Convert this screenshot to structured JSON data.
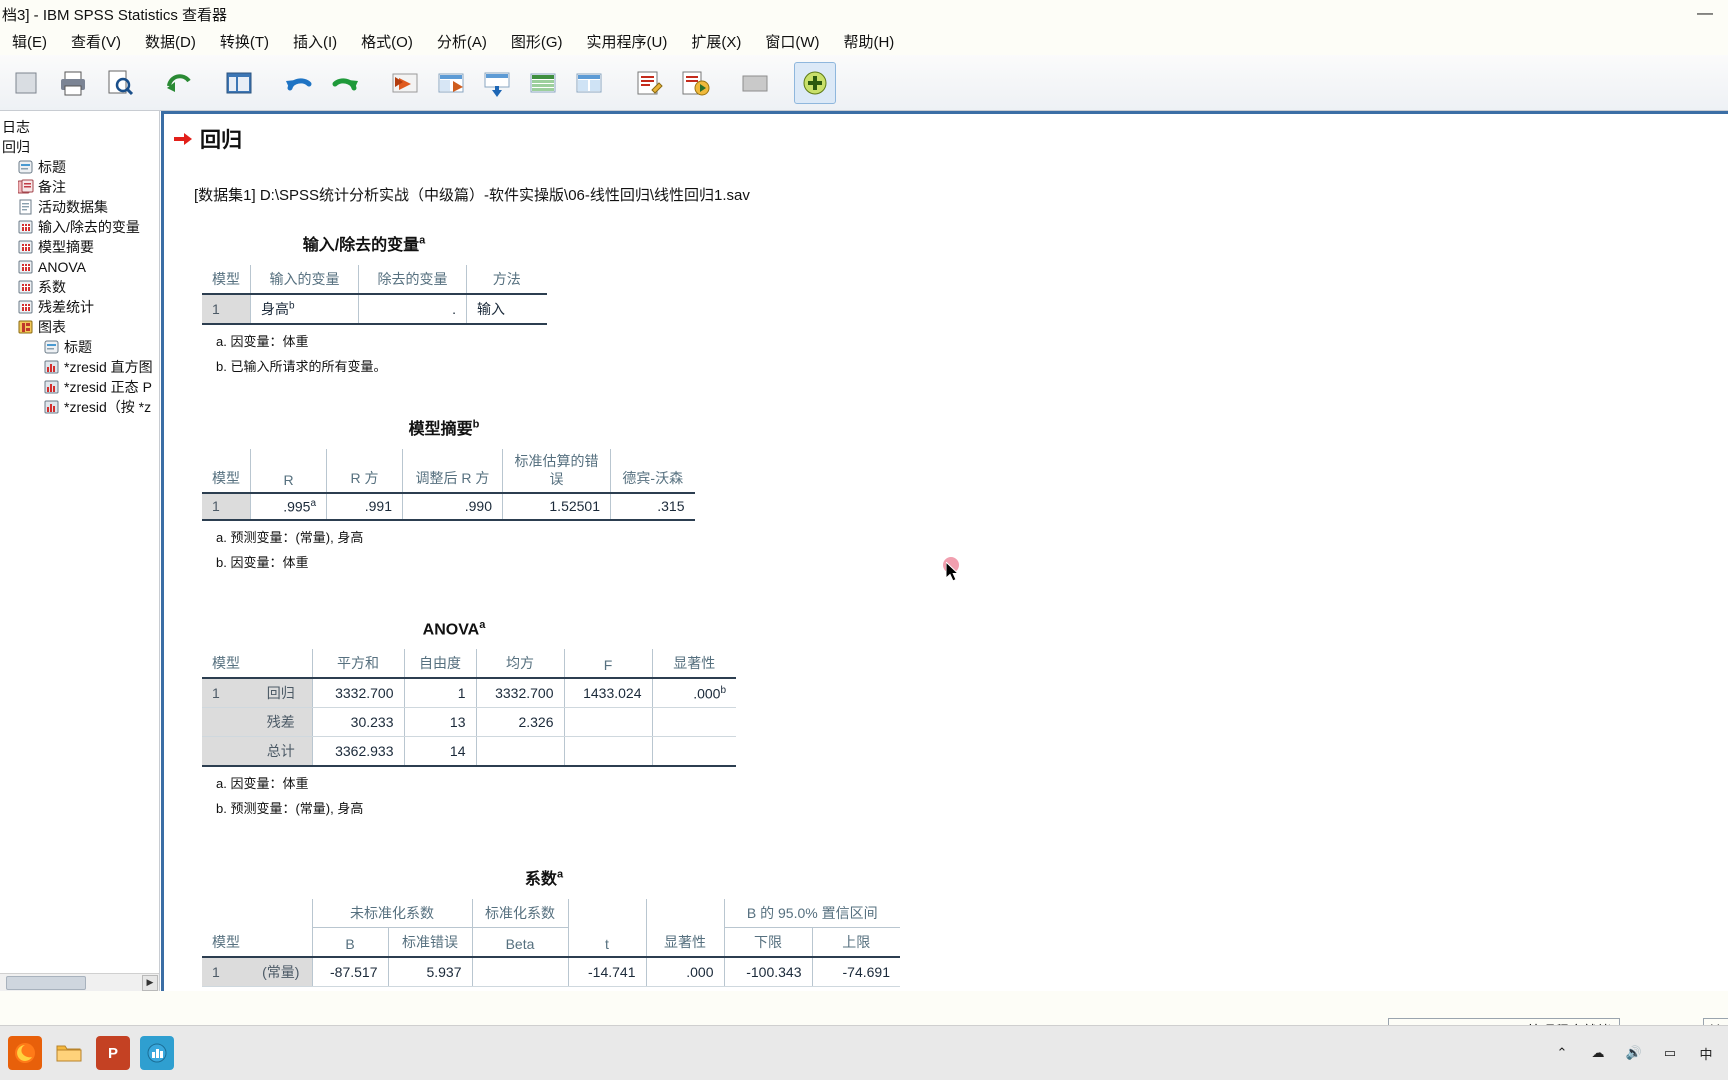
{
  "window": {
    "title": "档3] - IBM SPSS Statistics 查看器",
    "controls": [
      {
        "name": "minimize-button",
        "glyph": "—"
      },
      {
        "name": "maximize-button",
        "glyph": "▢"
      },
      {
        "name": "close-button",
        "glyph": "✕"
      }
    ]
  },
  "menubar": {
    "items": [
      {
        "label": "辑(E)",
        "name": "menu-edit"
      },
      {
        "label": "查看(V)",
        "name": "menu-view"
      },
      {
        "label": "数据(D)",
        "name": "menu-data"
      },
      {
        "label": "转换(T)",
        "name": "menu-transform"
      },
      {
        "label": "插入(I)",
        "name": "menu-insert"
      },
      {
        "label": "格式(O)",
        "name": "menu-format"
      },
      {
        "label": "分析(A)",
        "name": "menu-analyze"
      },
      {
        "label": "图形(G)",
        "name": "menu-graphs"
      },
      {
        "label": "实用程序(U)",
        "name": "menu-utilities"
      },
      {
        "label": "扩展(X)",
        "name": "menu-extensions"
      },
      {
        "label": "窗口(W)",
        "name": "menu-window"
      },
      {
        "label": "帮助(H)",
        "name": "menu-help"
      }
    ]
  },
  "toolbar": {
    "buttons": [
      {
        "name": "print-button",
        "icon": "printer-icon"
      },
      {
        "name": "print-preview-button",
        "icon": "print-preview-icon"
      },
      {
        "name": "export-button",
        "icon": "export-icon"
      },
      {
        "name": "dialog-recall-button",
        "icon": "dialog-recall-icon"
      },
      {
        "name": "undo-button",
        "icon": "undo-icon"
      },
      {
        "name": "redo-button",
        "icon": "redo-icon"
      },
      {
        "name": "goto-case-button",
        "icon": "goto-case-icon"
      },
      {
        "name": "goto-variable-button",
        "icon": "goto-variable-icon"
      },
      {
        "name": "insert-table-button",
        "icon": "insert-table-icon"
      },
      {
        "name": "show-hide-button",
        "icon": "show-hide-icon"
      },
      {
        "name": "syntax-editor-button",
        "icon": "syntax-editor-icon"
      },
      {
        "name": "run-button",
        "icon": "run-icon"
      },
      {
        "name": "variables-button",
        "icon": "variables-icon"
      },
      {
        "name": "add-note-button",
        "icon": "add-note-icon"
      }
    ]
  },
  "outline": {
    "items": [
      {
        "label": "日志",
        "depth": 1,
        "icon": "log-icon",
        "name": "outline-item-log"
      },
      {
        "label": "回归",
        "depth": 1,
        "icon": "folder-icon",
        "name": "outline-item-regression"
      },
      {
        "label": "标题",
        "depth": 2,
        "icon": "title-icon",
        "name": "outline-item-title"
      },
      {
        "label": "备注",
        "depth": 2,
        "icon": "notes-icon",
        "name": "outline-item-notes"
      },
      {
        "label": "活动数据集",
        "depth": 2,
        "icon": "dataset-icon",
        "name": "outline-item-active-dataset"
      },
      {
        "label": "输入/除去的变量",
        "depth": 2,
        "icon": "table-icon",
        "name": "outline-item-variables-entered-removed"
      },
      {
        "label": "模型摘要",
        "depth": 2,
        "icon": "table-icon",
        "name": "outline-item-model-summary"
      },
      {
        "label": "ANOVA",
        "depth": 2,
        "icon": "table-icon",
        "name": "outline-item-anova"
      },
      {
        "label": "系数",
        "depth": 2,
        "icon": "table-icon",
        "name": "outline-item-coefficients"
      },
      {
        "label": "残差统计",
        "depth": 2,
        "icon": "table-icon",
        "name": "outline-item-residual-statistics"
      },
      {
        "label": "图表",
        "depth": 2,
        "icon": "charts-icon",
        "name": "outline-item-charts"
      },
      {
        "label": "标题",
        "depth": 3,
        "icon": "title-icon",
        "name": "outline-item-chart-title"
      },
      {
        "label": "*zresid 直方图",
        "depth": 3,
        "icon": "chart-icon",
        "name": "outline-item-zresid-histogram"
      },
      {
        "label": "*zresid 正态 P",
        "depth": 3,
        "icon": "chart-icon",
        "name": "outline-item-zresid-normal-pp"
      },
      {
        "label": "*zresid（按 *z",
        "depth": 3,
        "icon": "chart-icon",
        "name": "outline-item-zresid-scatter"
      }
    ]
  },
  "document": {
    "section_title": "回归",
    "dataset_line": "[数据集1] D:\\SPSS统计分析实战（中级篇）-软件实操版\\06-线性回归\\线性回归1.sav",
    "tables": [
      {
        "name": "variables-entered-removed-table",
        "title": "输入/除去的变量",
        "title_sup": "a",
        "headers": [
          "模型",
          "输入的变量",
          "除去的变量",
          "方法"
        ],
        "rows": [
          {
            "cells": [
              "1",
              "身高",
              ".",
              "输入"
            ],
            "sup": {
              "1": "b"
            }
          }
        ],
        "footnotes": [
          "a. 因变量：体重",
          "b. 已输入所请求的所有变量。"
        ]
      },
      {
        "name": "model-summary-table",
        "title": "模型摘要",
        "title_sup": "b",
        "headers": [
          "模型",
          "R",
          "R 方",
          "调整后 R 方",
          "标准估算的错误",
          "德宾-沃森"
        ],
        "rows": [
          {
            "cells": [
              "1",
              ".995",
              ".991",
              ".990",
              "1.52501",
              ".315"
            ],
            "sup": {
              "1": "a"
            }
          }
        ],
        "footnotes": [
          "a. 预测变量：(常量), 身高",
          "b. 因变量：体重"
        ]
      },
      {
        "name": "anova-table",
        "title": "ANOVA",
        "title_sup": "a",
        "headers": [
          "模型",
          "",
          "平方和",
          "自由度",
          "均方",
          "F",
          "显著性"
        ],
        "rows": [
          {
            "cells": [
              "1",
              "回归",
              "3332.700",
              "1",
              "3332.700",
              "1433.024",
              ".000"
            ],
            "sup": {
              "6": "b"
            }
          },
          {
            "cells": [
              "",
              "残差",
              "30.233",
              "13",
              "2.326",
              "",
              ""
            ]
          },
          {
            "cells": [
              "",
              "总计",
              "3362.933",
              "14",
              "",
              "",
              ""
            ]
          }
        ],
        "footnotes": [
          "a. 因变量：体重",
          "b. 预测变量：(常量), 身高"
        ]
      },
      {
        "name": "coefficients-table",
        "title": "系数",
        "title_sup": "a",
        "group_headers": [
          "未标准化系数",
          "标准化系数",
          "B 的 95.0% 置信区间"
        ],
        "headers": [
          "模型",
          "",
          "B",
          "标准错误",
          "Beta",
          "t",
          "显著性",
          "下限",
          "上限"
        ],
        "rows": [
          {
            "cells": [
              "1",
              "(常量)",
              "-87.517",
              "5.937",
              "",
              "-14.741",
              ".000",
              "-100.343",
              "-74.691"
            ]
          }
        ]
      }
    ]
  },
  "statusbar": {
    "processor_text": "IBM SPSS Statistics 处理程序就绪",
    "unicode_text": "Unic"
  },
  "taskbar": {
    "apps": [
      {
        "name": "taskbar-firefox",
        "icon": "firefox-icon",
        "color": "#e8600a"
      },
      {
        "name": "taskbar-file-explorer",
        "icon": "folder-icon",
        "color": "#f5b83d"
      },
      {
        "name": "taskbar-powerpoint",
        "icon": "powerpoint-icon",
        "color": "#c44123"
      },
      {
        "name": "taskbar-spss",
        "icon": "spss-icon",
        "color": "#2f9fd0"
      }
    ],
    "tray": [
      {
        "name": "tray-show-hidden-icon",
        "glyph": "^"
      },
      {
        "name": "tray-cloud-icon",
        "glyph": "☁"
      },
      {
        "name": "tray-volume-icon",
        "glyph": "🔊"
      },
      {
        "name": "tray-network-icon",
        "glyph": "▭"
      },
      {
        "name": "tray-ime-icon",
        "glyph": "中"
      }
    ]
  },
  "colors": {
    "accent": "#3b6ea5",
    "red_arrow": "#e2201a",
    "table_header_text": "#56707f",
    "row_header_bg": "#dcdcdc"
  }
}
